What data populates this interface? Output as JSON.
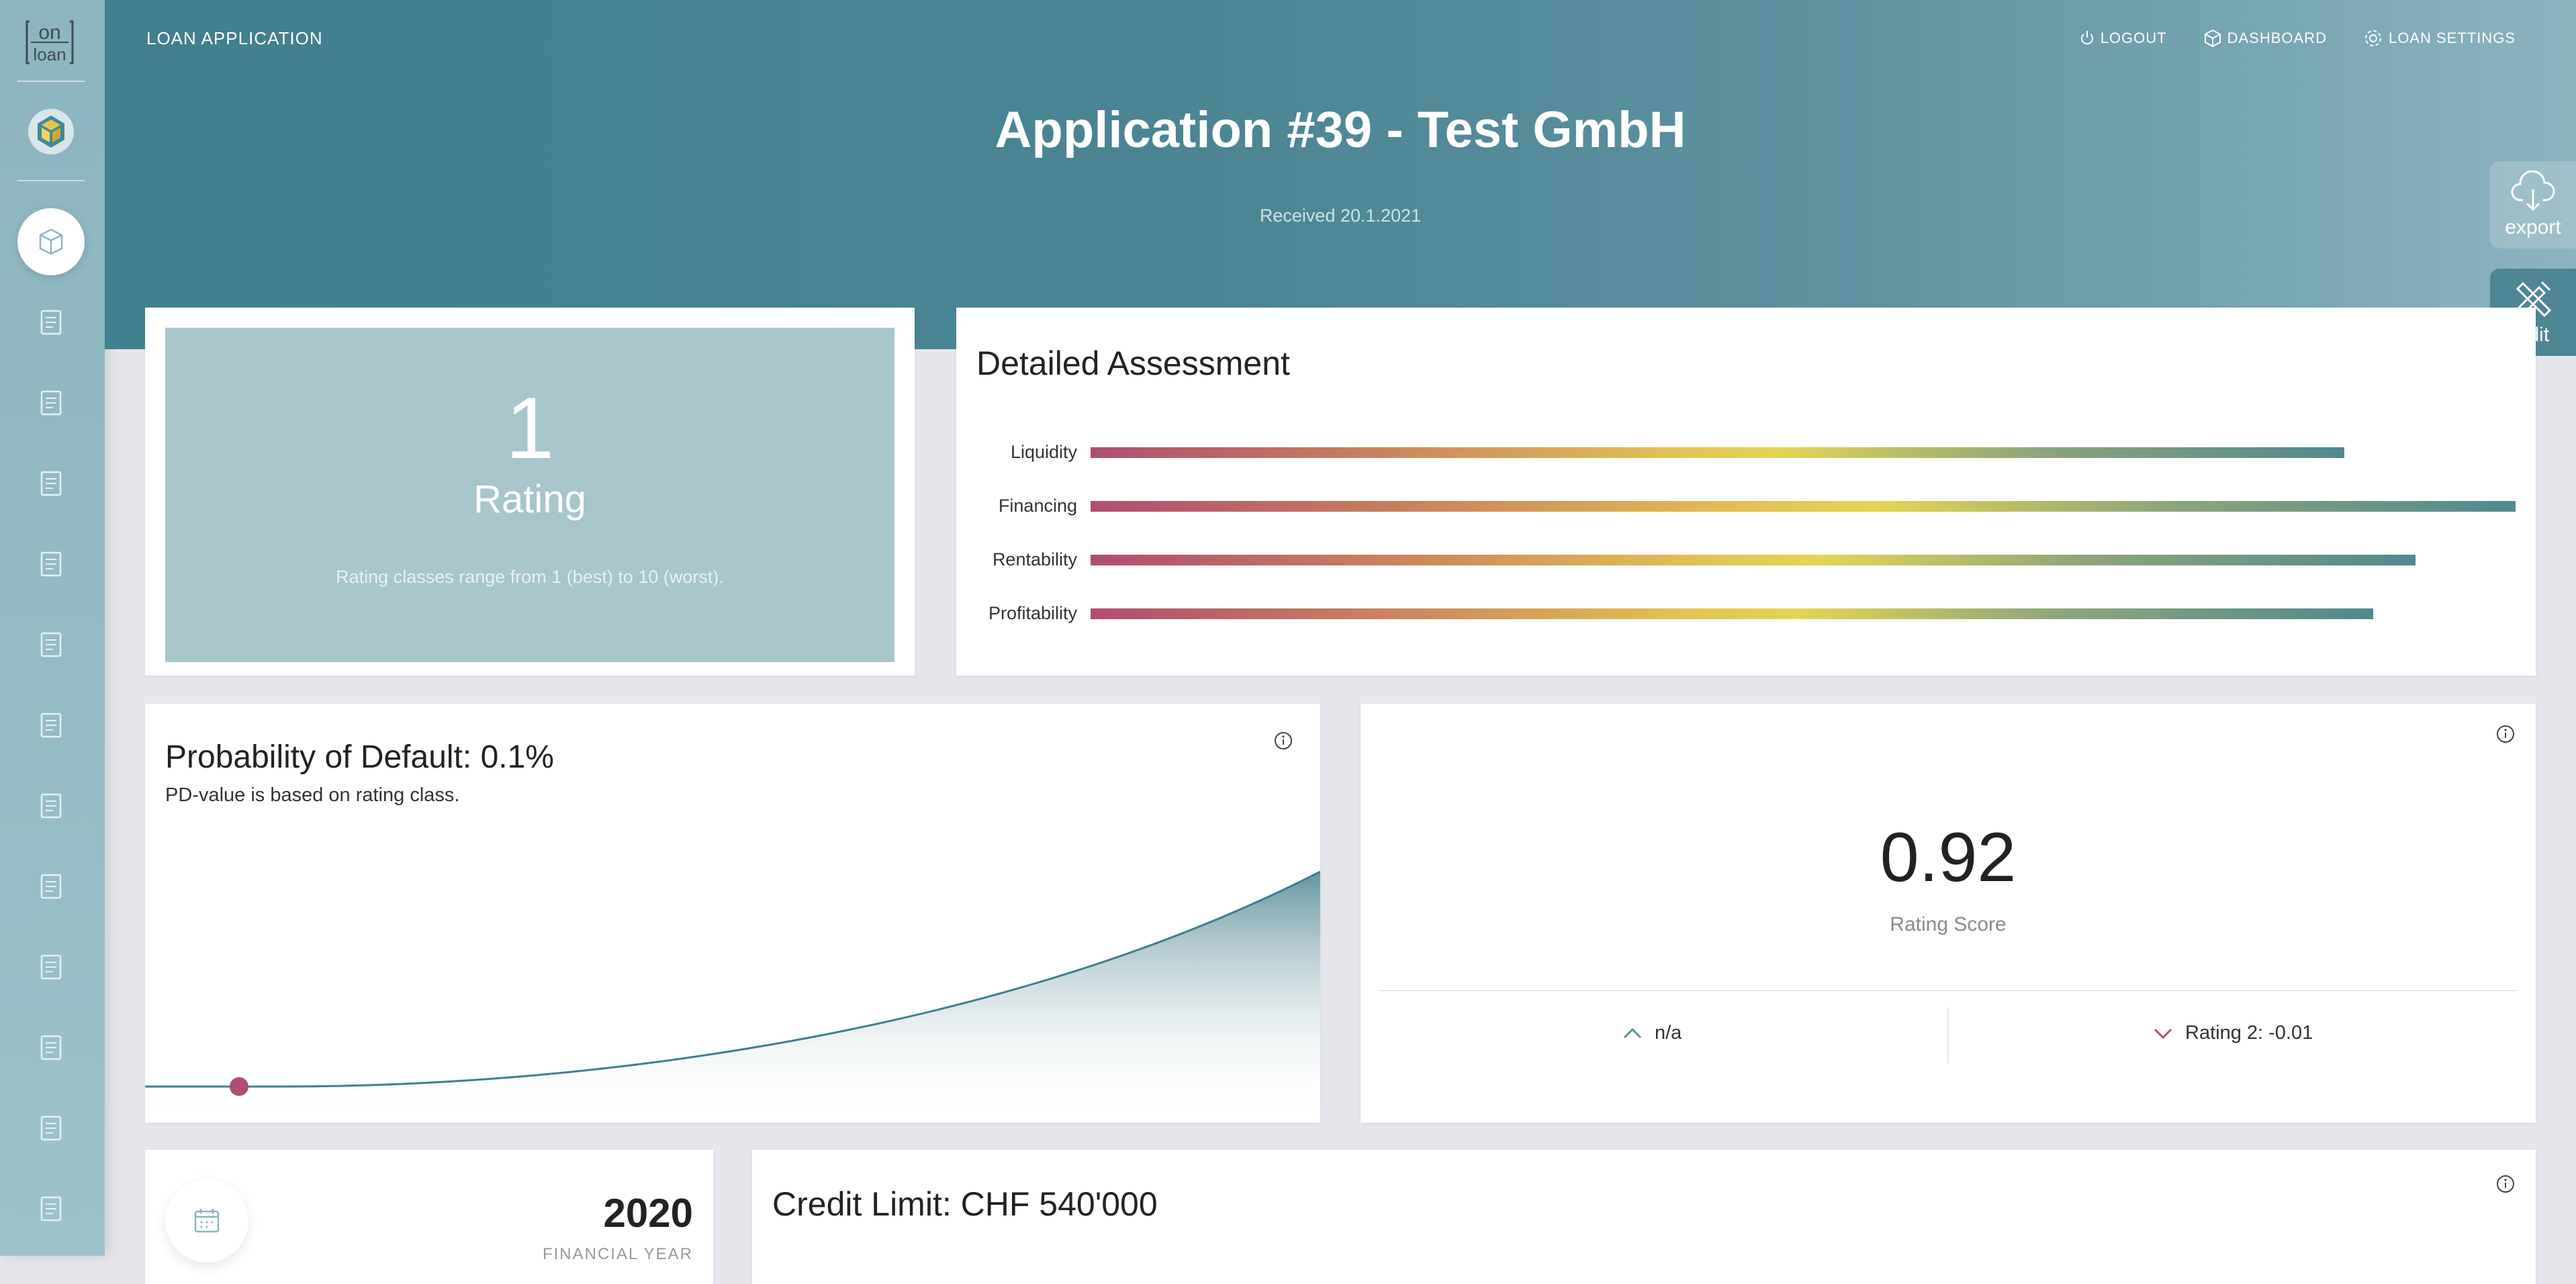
{
  "app": {
    "label": "LOAN APPLICATION"
  },
  "logo": {
    "text_top": "on",
    "text_bottom": "loan"
  },
  "nav": {
    "logout": "LOGOUT",
    "dashboard": "DASHBOARD",
    "settings": "LOAN SETTINGS"
  },
  "header": {
    "title": "Application #39 - Test GmbH",
    "received": "Received 20.1.2021"
  },
  "actions": {
    "export": "export",
    "edit": "edit"
  },
  "sidebar": {
    "active_icon": "cube-icon",
    "doc_items": 12
  },
  "rating": {
    "value": "1",
    "label": "Rating",
    "note": "Rating classes range from 1 (best) to 10 (worst)."
  },
  "assessment": {
    "title": "Detailed Assessment",
    "rows": [
      {
        "label": "Liquidity",
        "value": 0.88
      },
      {
        "label": "Financing",
        "value": 1.0
      },
      {
        "label": "Rentability",
        "value": 0.93
      },
      {
        "label": "Profitability",
        "value": 0.9
      }
    ]
  },
  "pd": {
    "title": "Probability of Default: 0.1%",
    "subtitle": "PD-value is based on rating class."
  },
  "score": {
    "value": "0.92",
    "label": "Rating Score",
    "up": "n/a",
    "down": "Rating 2: -0.01"
  },
  "year": {
    "value": "2020",
    "label": "FINANCIAL YEAR"
  },
  "credit": {
    "title": "Credit Limit: CHF 540'000"
  },
  "colors": {
    "primary": "#407f8d",
    "accent": "#b04d72",
    "rating_bg": "#a6c6cc"
  }
}
